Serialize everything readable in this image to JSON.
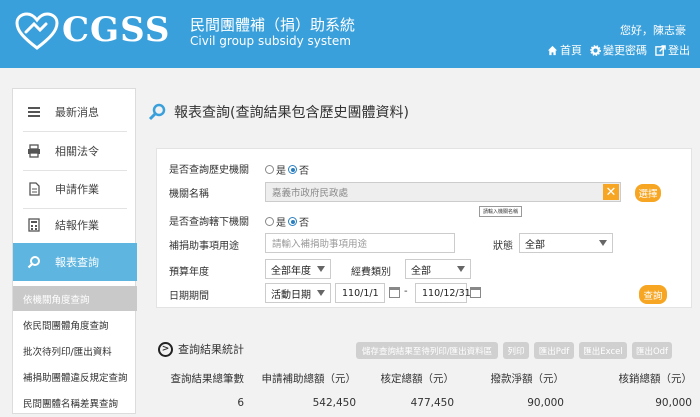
{
  "header": {
    "logo_text": "CGSS",
    "system_name_cn": "民間團體補（捐）助系統",
    "system_name_en": "Civil group subsidy system",
    "greeting": "您好，陳志豪",
    "links": [
      {
        "label": "首頁",
        "icon": "home-icon"
      },
      {
        "label": "變更密碼",
        "icon": "gear-icon"
      },
      {
        "label": "登出",
        "icon": "logout-icon"
      }
    ],
    "accent_color": "#3aa0dc"
  },
  "sidebar": {
    "items": [
      {
        "label": "最新消息",
        "icon": "list-icon"
      },
      {
        "label": "相關法令",
        "icon": "printer-icon"
      },
      {
        "label": "申請作業",
        "icon": "document-icon"
      },
      {
        "label": "結報作業",
        "icon": "calculator-icon"
      },
      {
        "label": "報表查詢",
        "icon": "search-icon"
      }
    ],
    "active_item": "報表查詢",
    "subitems": [
      "依機關角度查詢",
      "依民間團體角度查詢",
      "批次待列印/匯出資料",
      "補捐助團體違反規定查詢",
      "民間團體名稱差異查詢"
    ],
    "active_subitem": "依機關角度查詢"
  },
  "main": {
    "title": "報表查詢(查詢結果包含歷史團體資料)",
    "form": {
      "history_label": "是否查詢歷史機關",
      "sub_label": "是否查詢轄下機關",
      "agency_label": "機關名稱",
      "agency_value": "嘉義市政府民政處",
      "tooltip": "請輸入機關名稱",
      "select_button": "選擇",
      "purpose_label": "補捐助事項用途",
      "purpose_placeholder": "請輸入補捐助事項用途",
      "status_label": "狀態",
      "status_value": "全部",
      "budget_year_label": "預算年度",
      "budget_year_value": "全部年度",
      "expense_type_label": "經費類別",
      "expense_type_value": "全部",
      "date_range_label": "日期期間",
      "date_type_value": "活動日期",
      "date_from": "110/1/1",
      "date_sep": "-",
      "date_to": "110/12/31",
      "query_button": "查詢",
      "yes_label": "是",
      "no_label": "否",
      "history_selected": "否",
      "sub_selected": "否"
    },
    "results": {
      "title": "查詢結果統計",
      "buttons": [
        "儲存查詢結果至待列印/匯出資料區",
        "列印",
        "匯出Pdf",
        "匯出Excel",
        "匯出Odf"
      ],
      "columns": [
        "查詢結果總筆數",
        "申請補助總額（元）",
        "核定總額（元）",
        "撥款淨額（元）",
        "核銷總額（元）"
      ],
      "rows": [
        [
          "6",
          "542,450",
          "477,450",
          "90,000",
          "90,000"
        ]
      ]
    }
  }
}
